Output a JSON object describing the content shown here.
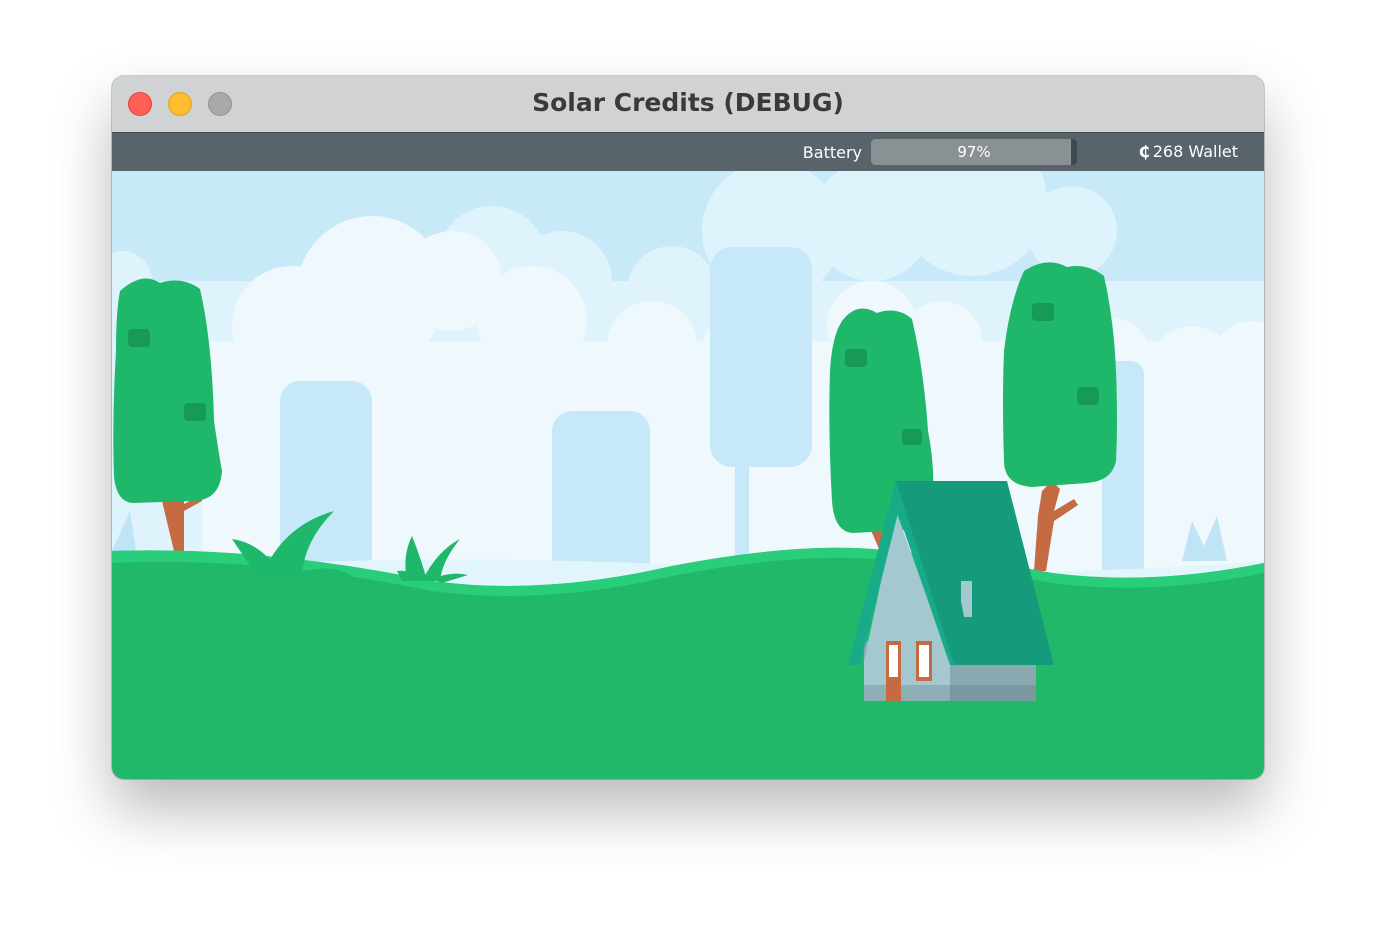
{
  "window": {
    "title": "Solar Credits (DEBUG)"
  },
  "toolbar": {
    "battery_label": "Battery",
    "battery_percent_text": "97%",
    "battery_level": 0.97,
    "wallet_currency_symbol": "₵",
    "wallet_amount": "268",
    "wallet_label": "Wallet"
  },
  "colors": {
    "sky": "#c8e9f8",
    "clouds": "#eaf7fd",
    "ground": "#21b86a",
    "tree_foliage": "#1fb86a",
    "tree_trunk": "#c56a43",
    "house_roof": "#169a7c",
    "house_wall": "#a3c8d0",
    "toolbar": "#58646a"
  },
  "icons": {
    "close": "close-icon",
    "minimize": "minimize-icon",
    "zoom": "zoom-icon"
  }
}
